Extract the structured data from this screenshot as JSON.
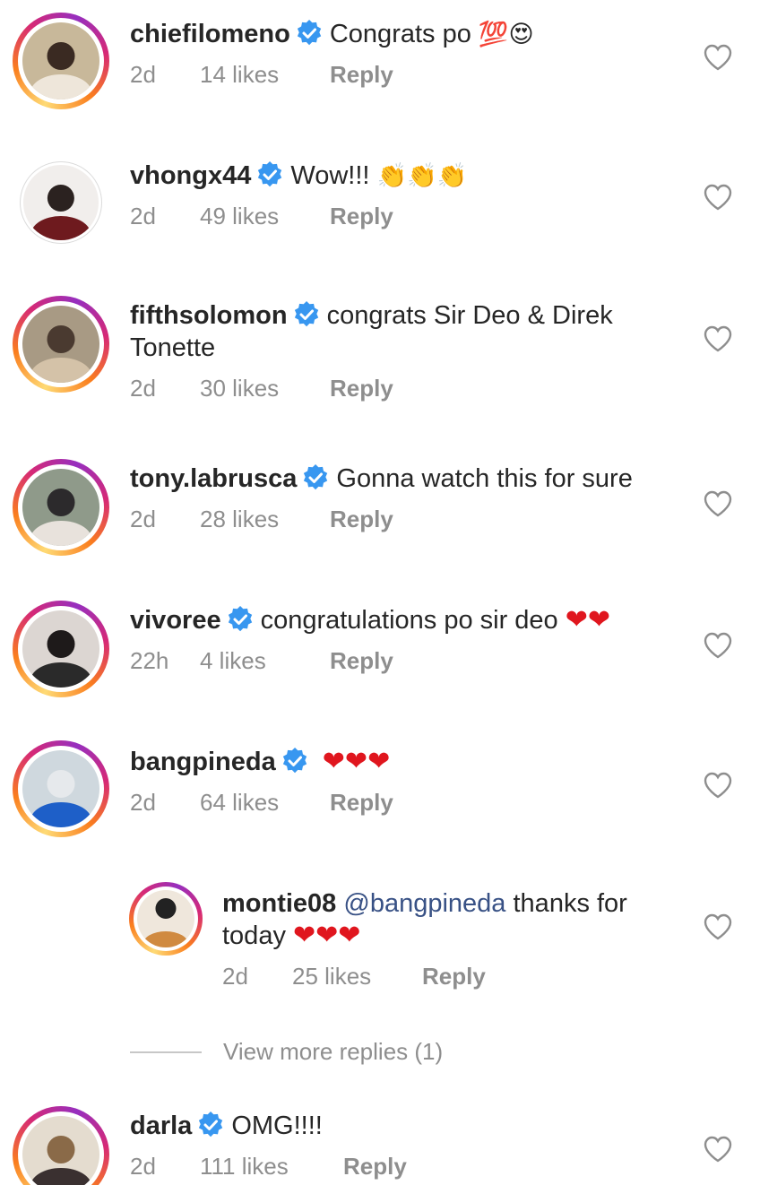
{
  "comments": [
    {
      "username": "chiefilomeno",
      "text": "Congrats po",
      "emojis": "💯😍",
      "time": "2d",
      "likes": "14 likes",
      "reply": "Reply"
    },
    {
      "username": "vhongx44",
      "text": "Wow!!!",
      "emojis": "👏👏👏",
      "time": "2d",
      "likes": "49 likes",
      "reply": "Reply"
    },
    {
      "username": "fifthsolomon",
      "text": "congrats Sir Deo & Direk",
      "text2": "Tonette",
      "time": "2d",
      "likes": "30 likes",
      "reply": "Reply"
    },
    {
      "username": "tony.labrusca",
      "text": "Gonna watch this for sure",
      "time": "2d",
      "likes": "28 likes",
      "reply": "Reply"
    },
    {
      "username": "vivoree",
      "text": "congratulations po sir deo",
      "emojis": "❤❤",
      "time": "22h",
      "likes": "4 likes",
      "reply": "Reply"
    },
    {
      "username": "bangpineda",
      "emojis": "❤❤❤",
      "time": "2d",
      "likes": "64 likes",
      "reply": "Reply"
    },
    {
      "username": "montie08",
      "mention": "@bangpineda",
      "text": "thanks for",
      "text2": "today",
      "emojis": "❤❤❤",
      "time": "2d",
      "likes": "25 likes",
      "reply": "Reply"
    },
    {
      "username": "darla",
      "text": "OMG!!!!",
      "time": "2d",
      "likes": "111 likes",
      "reply": "Reply"
    }
  ],
  "view_more_replies": "View more replies (1)",
  "colors": {
    "verified": "#3897f0",
    "heart_emoji": "#e0161e",
    "mention": "#385185",
    "meta": "#8e8e8e"
  },
  "icons": {
    "verified": "verified-badge-icon",
    "like": "heart-outline-icon"
  }
}
